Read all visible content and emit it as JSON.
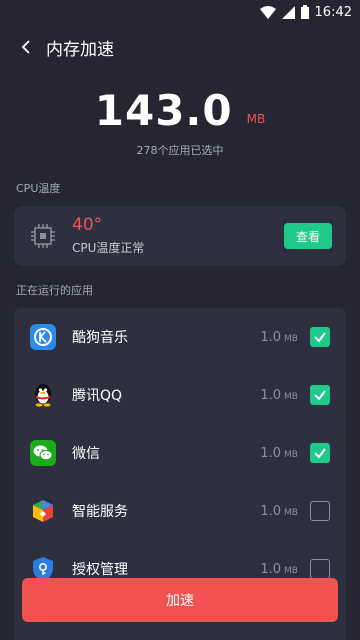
{
  "status_bar": {
    "time": "16:42"
  },
  "header": {
    "title": "内存加速"
  },
  "memory": {
    "value": "143.0",
    "unit": "MB",
    "selected_text": "278个应用已选中"
  },
  "cpu": {
    "section_label": "CPU温度",
    "temperature": "40°",
    "status": "CPU温度正常",
    "view_label": "查看"
  },
  "apps_section": {
    "label": "正在运行的应用",
    "items": [
      {
        "name": "酷狗音乐",
        "size": "1.0",
        "unit": "MB",
        "checked": true,
        "icon": "kugou-music-icon"
      },
      {
        "name": "腾讯QQ",
        "size": "1.0",
        "unit": "MB",
        "checked": true,
        "icon": "qq-penguin-icon"
      },
      {
        "name": "微信",
        "size": "1.0",
        "unit": "MB",
        "checked": true,
        "icon": "wechat-icon"
      },
      {
        "name": "智能服务",
        "size": "1.0",
        "unit": "MB",
        "checked": false,
        "icon": "smart-service-icon"
      },
      {
        "name": "授权管理",
        "size": "1.0",
        "unit": "MB",
        "checked": false,
        "icon": "authorization-icon"
      }
    ]
  },
  "boost_button": {
    "label": "加速"
  },
  "colors": {
    "background": "#252631",
    "card": "#2e3040",
    "accent_green": "#1fc98a",
    "accent_red": "#f25151"
  }
}
